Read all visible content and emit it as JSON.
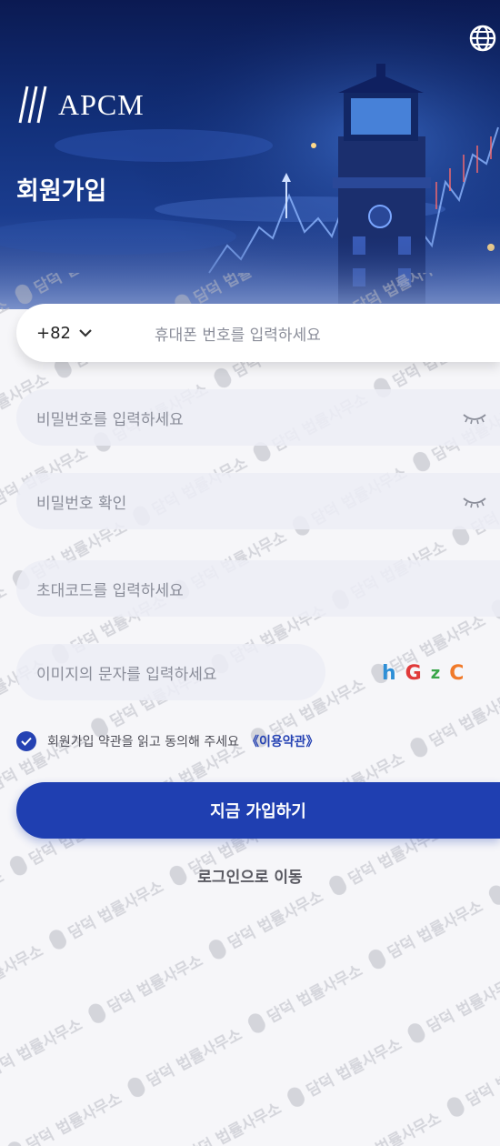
{
  "header": {
    "logo_text": "APCM",
    "page_title": "회원가입",
    "language_icon": "globe-icon"
  },
  "form": {
    "country_code": "+82",
    "phone_placeholder": "휴대폰 번호를 입력하세요",
    "password_placeholder": "비밀번호를 입력하세요",
    "password_confirm_placeholder": "비밀번호 확인",
    "invite_code_placeholder": "초대코드를 입력하세요",
    "captcha_placeholder": "이미지의 문자를 입력하세요",
    "captcha_chars": [
      {
        "char": "h",
        "color": "#2e8fd6"
      },
      {
        "char": "G",
        "color": "#e03a3a"
      },
      {
        "char": "z",
        "color": "#3aa64a"
      },
      {
        "char": "C",
        "color": "#f07a2a"
      }
    ]
  },
  "agreement": {
    "text": "회원가입 약관을 읽고 동의해 주세요",
    "link": "《이용약관》",
    "checked": true
  },
  "actions": {
    "submit_label": "지금 가입하기",
    "login_label": "로그인으로 이동"
  },
  "watermark": {
    "text": "담덕 법률사무소"
  },
  "colors": {
    "primary": "#1f3fb1",
    "hero_dark": "#0b1a52"
  }
}
